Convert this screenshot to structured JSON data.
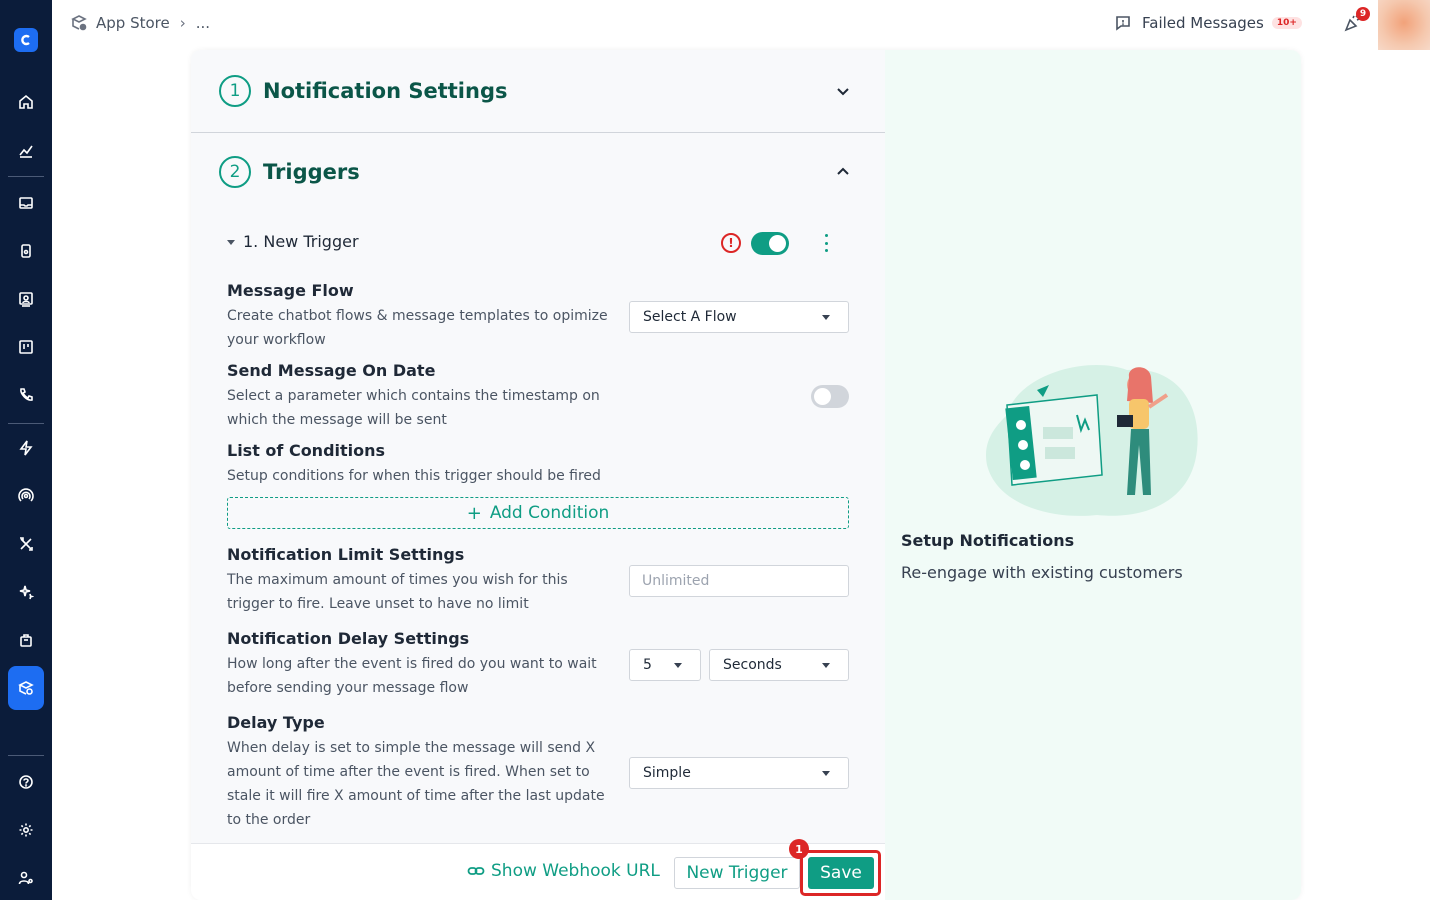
{
  "breadcrumb": {
    "app": "App Store",
    "more": "..."
  },
  "topbar": {
    "failed_label": "Failed Messages",
    "failed_badge": "10+",
    "notif_count": "9"
  },
  "sections": [
    {
      "number": "1",
      "title": "Notification Settings",
      "state": "collapsed"
    },
    {
      "number": "2",
      "title": "Triggers",
      "state": "expanded"
    }
  ],
  "trigger": {
    "name": "1. New Trigger",
    "warning_icon": "!",
    "enabled": true
  },
  "fields": {
    "message_flow": {
      "title": "Message Flow",
      "desc": "Create chatbot flows & message templates to opimize your workflow",
      "value": "Select A Flow"
    },
    "send_on_date": {
      "title": "Send Message On Date",
      "desc": "Select a parameter which contains the timestamp on which the message will be sent",
      "enabled": false
    },
    "conditions": {
      "title": "List of Conditions",
      "desc": "Setup conditions for when this trigger should be fired",
      "add_label": "Add Condition"
    },
    "limit": {
      "title": "Notification Limit Settings",
      "desc": "The maximum amount of times you wish for this trigger to fire. Leave unset to have no limit",
      "placeholder": "Unlimited"
    },
    "delay": {
      "title": "Notification Delay Settings",
      "desc": "How long after the event is fired do you want to wait before sending your message flow",
      "amount": "5",
      "unit": "Seconds"
    },
    "delay_type": {
      "title": "Delay Type",
      "desc": "When delay is set to simple the message will send X amount of time after the event is fired. When set to stale it will fire X amount of time after the last update to the order",
      "value": "Simple"
    }
  },
  "footer": {
    "webhook_label": "Show Webhook URL",
    "new_trigger_label": "New Trigger",
    "save_label": "Save",
    "save_marker": "1"
  },
  "side_panel": {
    "title": "Setup Notifications",
    "subtitle": "Re-engage with existing customers"
  },
  "colors": {
    "accent": "#0f9d84",
    "sidebar": "#0b1c3a",
    "danger": "#dc2626",
    "active_nav": "#1d6df2"
  }
}
